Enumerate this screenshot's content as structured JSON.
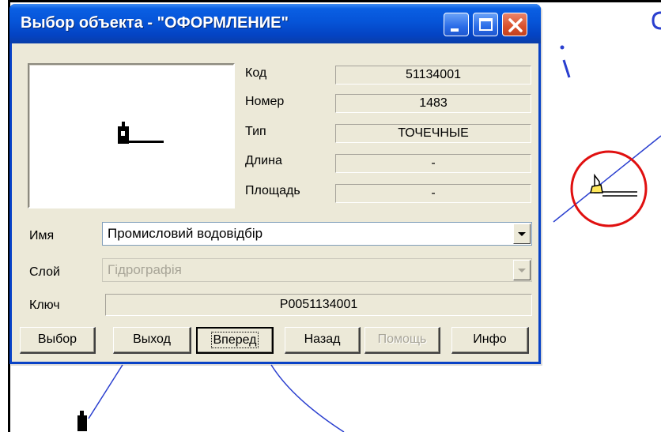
{
  "window": {
    "title": "Выбор объекта - \"ОФОРМЛЕНИЕ\""
  },
  "properties": {
    "code_label": "Код",
    "code_value": "51134001",
    "number_label": "Номер",
    "number_value": "1483",
    "type_label": "Тип",
    "type_value": "ТОЧЕЧНЫЕ",
    "length_label": "Длина",
    "length_value": "-",
    "area_label": "Площадь",
    "area_value": "-"
  },
  "form": {
    "name_label": "Имя",
    "name_value": "Промисловий водовідбір",
    "layer_label": "Слой",
    "layer_value": "Гідрографія",
    "key_label": "Ключ",
    "key_value": "P0051134001"
  },
  "buttons": {
    "select": "Выбор",
    "exit": "Выход",
    "forward": "Вперед",
    "back": "Назад",
    "help": "Помощь",
    "info": "Инфо"
  },
  "colors": {
    "title_bar": "#0654d8",
    "map_line": "#2a3fcf",
    "highlight_circle": "#e01010",
    "dialog_face": "#ece9d8"
  },
  "icons": {
    "object_symbol": "water-intake-symbol",
    "minimize": "minimize-icon",
    "maximize": "maximize-icon",
    "close": "close-icon"
  }
}
